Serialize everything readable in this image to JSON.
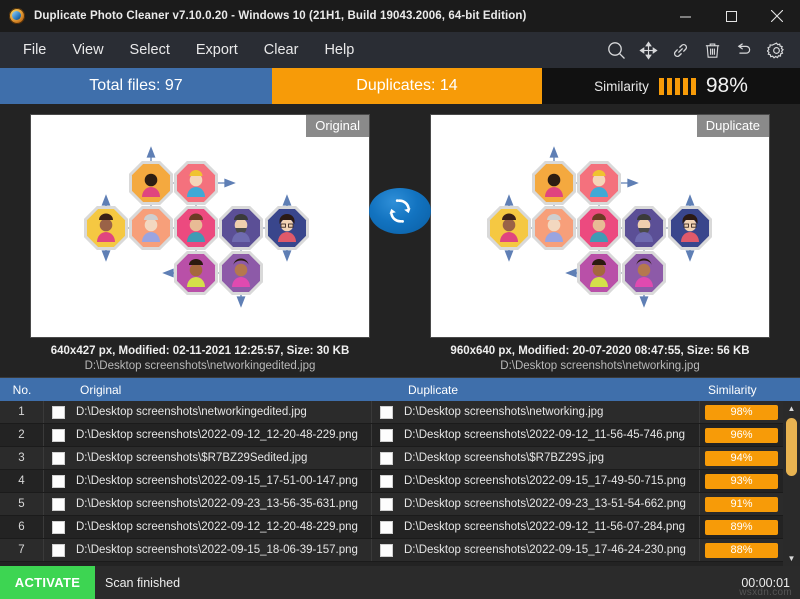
{
  "window": {
    "title": "Duplicate Photo Cleaner v7.10.0.20 - Windows 10 (21H1, Build 19043.2006, 64-bit Edition)",
    "app_icon": "app-logo-icon",
    "minimize_label": "minimize-icon",
    "maximize_label": "maximize-icon",
    "close_label": "close-icon"
  },
  "menu": {
    "items": [
      {
        "label": "File"
      },
      {
        "label": "View"
      },
      {
        "label": "Select"
      },
      {
        "label": "Export"
      },
      {
        "label": "Clear"
      },
      {
        "label": "Help"
      }
    ],
    "tools": [
      {
        "name": "search-icon"
      },
      {
        "name": "move-icon"
      },
      {
        "name": "link-icon"
      },
      {
        "name": "trash-icon"
      },
      {
        "name": "undo-icon"
      },
      {
        "name": "settings-icon"
      }
    ]
  },
  "stats": {
    "total_files": "Total files: 97",
    "duplicates": "Duplicates: 14",
    "similarity_label": "Similarity",
    "similarity_value": "98%",
    "similarity_bars": 5,
    "color_total": "#3f6fab",
    "color_duplicates": "#f79b08"
  },
  "preview": {
    "swap_button": "swap-images-button",
    "left": {
      "badge": "Original",
      "meta": "640x427 px, Modified: 02-11-2021 12:25:57, Size: 30 KB",
      "path": "D:\\Desktop screenshots\\networkingedited.jpg"
    },
    "right": {
      "badge": "Duplicate",
      "meta": "960x640 px, Modified: 20-07-2020 08:47:55, Size: 56 KB",
      "path": "D:\\Desktop screenshots\\networking.jpg"
    }
  },
  "table": {
    "headers": {
      "no": "No.",
      "original": "Original",
      "duplicate": "Duplicate",
      "similarity": "Similarity"
    },
    "rows": [
      {
        "no": "1",
        "original": "D:\\Desktop screenshots\\networkingedited.jpg",
        "duplicate": "D:\\Desktop screenshots\\networking.jpg",
        "similarity": "98%"
      },
      {
        "no": "2",
        "original": "D:\\Desktop screenshots\\2022-09-12_12-20-48-229.png",
        "duplicate": "D:\\Desktop screenshots\\2022-09-12_11-56-45-746.png",
        "similarity": "96%"
      },
      {
        "no": "3",
        "original": "D:\\Desktop screenshots\\$R7BZ29Sedited.jpg",
        "duplicate": "D:\\Desktop screenshots\\$R7BZ29S.jpg",
        "similarity": "94%"
      },
      {
        "no": "4",
        "original": "D:\\Desktop screenshots\\2022-09-15_17-51-00-147.png",
        "duplicate": "D:\\Desktop screenshots\\2022-09-15_17-49-50-715.png",
        "similarity": "93%"
      },
      {
        "no": "5",
        "original": "D:\\Desktop screenshots\\2022-09-23_13-56-35-631.png",
        "duplicate": "D:\\Desktop screenshots\\2022-09-23_13-51-54-662.png",
        "similarity": "91%"
      },
      {
        "no": "6",
        "original": "D:\\Desktop screenshots\\2022-09-12_12-20-48-229.png",
        "duplicate": "D:\\Desktop screenshots\\2022-09-12_11-56-07-284.png",
        "similarity": "89%"
      },
      {
        "no": "7",
        "original": "D:\\Desktop screenshots\\2022-09-15_18-06-39-157.png",
        "duplicate": "D:\\Desktop screenshots\\2022-09-15_17-46-24-230.png",
        "similarity": "88%"
      }
    ],
    "scrollbar": {
      "up": "▲",
      "down": "▼"
    }
  },
  "status": {
    "activate": "ACTIVATE",
    "message": "Scan finished",
    "timer": "00:00:01",
    "watermark": "wsxdn.com"
  }
}
